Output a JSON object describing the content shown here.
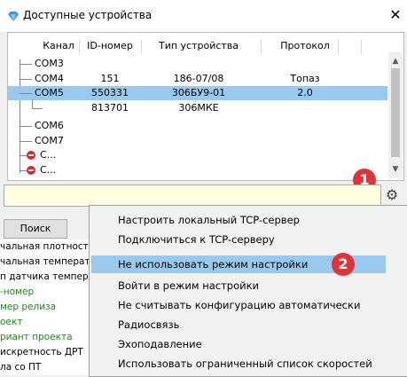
{
  "window": {
    "title": "Доступные устройства",
    "close": "✕",
    "icon": "diamond-app-icon",
    "colors": {
      "selection": "#99c9ef",
      "badge": "#e0343a",
      "hint_field": "#ffffe1"
    }
  },
  "tree": {
    "columns": [
      "Канал",
      "ID-номер",
      "Тип устройства",
      "Протокол"
    ],
    "rows": [
      {
        "name": "COM3",
        "id": "",
        "type": "",
        "protocol": ""
      },
      {
        "name": "COM4",
        "id": "151",
        "type": "186-07/08",
        "protocol": "Топаз"
      },
      {
        "name": "COM5",
        "id": "550331",
        "type": "306БУ9-01",
        "protocol": "2.0"
      },
      {
        "name": "",
        "id": "813701",
        "type": "306МКЕ",
        "protocol": ""
      },
      {
        "name": "COM6",
        "id": "",
        "type": "",
        "protocol": ""
      },
      {
        "name": "COM7",
        "id": "",
        "type": "",
        "protocol": ""
      },
      {
        "name": "С...",
        "id": "",
        "type": "",
        "protocol": ""
      },
      {
        "name": "С...",
        "id": "",
        "type": "",
        "protocol": ""
      }
    ],
    "scroll_up": "▲",
    "scroll_down": "▼"
  },
  "toolbar": {
    "settings_icon": "gear-icon",
    "settings_glyph": "⚙"
  },
  "search_button": "Поиск",
  "left_list": {
    "items": [
      {
        "text": "чальная плотность",
        "color": "black"
      },
      {
        "text": "чальная температ",
        "color": "black"
      },
      {
        "text": "п датчика темпера",
        "color": "black"
      },
      {
        "text": "-номер",
        "color": "green"
      },
      {
        "text": "мер релиза",
        "color": "green"
      },
      {
        "text": "оект",
        "color": "green"
      },
      {
        "text": "риант проекта",
        "color": "green"
      },
      {
        "text": "искретность ДРТ",
        "color": "black"
      },
      {
        "text": "ла со ПТ",
        "color": "black"
      }
    ]
  },
  "context_menu": {
    "items": [
      "Настроить локальный TCP-сервер",
      "Подключиться к TCP-серверу",
      "Не использовать режим настройки",
      "Войти в режим настройки",
      "Не считывать конфигурацию автоматически",
      "Радиосвязь",
      "Эхоподавление",
      "Использовать ограниченный список скоростей"
    ]
  },
  "badges": {
    "first": "1",
    "second": "2"
  }
}
